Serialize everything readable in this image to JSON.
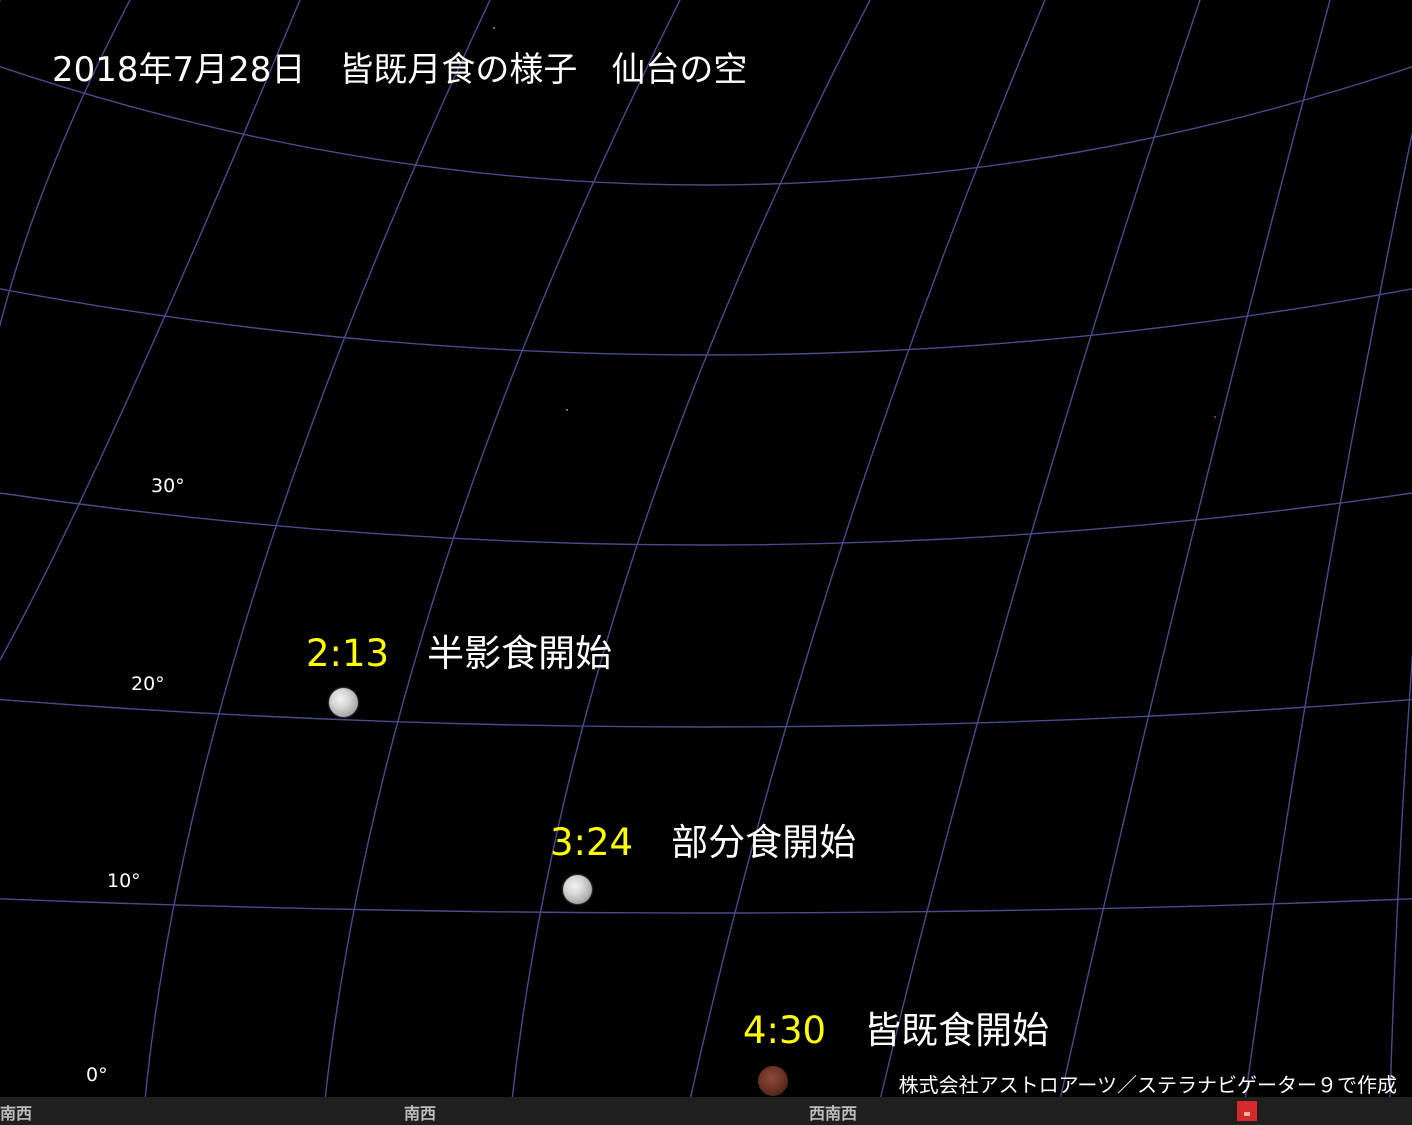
{
  "title": "2018年7月28日　皆既月食の様子　仙台の空",
  "altitude_labels": [
    "30°",
    "20°",
    "10°",
    "0°"
  ],
  "events": [
    {
      "time": "2:13",
      "name": "半影食開始"
    },
    {
      "time": "3:24",
      "name": "部分食開始"
    },
    {
      "time": "4:30",
      "name": "皆既食開始"
    }
  ],
  "credit": "株式会社アストロアーツ／ステラナビゲーター９で作成",
  "horizon_directions": [
    "南西",
    "南西",
    "西南西"
  ],
  "colors": {
    "sky": "#000000",
    "grid": "#4a4a8c",
    "time_text": "#ffff00",
    "label_text": "#ffffff",
    "horizon_bar": "#1f1f1f",
    "marker": "#d42a2a"
  }
}
